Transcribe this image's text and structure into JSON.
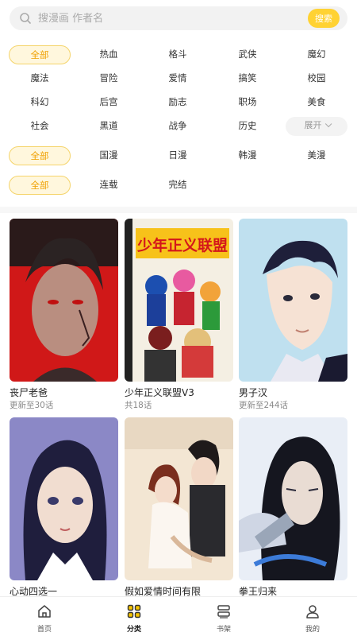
{
  "search": {
    "placeholder": "搜漫画 作者名",
    "button_label": "搜索"
  },
  "filters": {
    "genre": [
      "全部",
      "热血",
      "格斗",
      "武侠",
      "魔幻",
      "魔法",
      "冒险",
      "爱情",
      "搞笑",
      "校园",
      "科幻",
      "后宫",
      "励志",
      "职场",
      "美食",
      "社会",
      "黑道",
      "战争",
      "历史"
    ],
    "expand_label": "展开",
    "region": [
      "全部",
      "国漫",
      "日漫",
      "韩漫",
      "美漫"
    ],
    "status": [
      "全部",
      "连载",
      "完结"
    ]
  },
  "comics": [
    {
      "title": "丧尸老爸",
      "subtitle": "更新至30话"
    },
    {
      "title": "少年正义联盟V3",
      "subtitle": "共18话",
      "cover_text": "少年正义联盟"
    },
    {
      "title": "男子汉",
      "subtitle": "更新至244话"
    },
    {
      "title": "心动四选一",
      "subtitle": ""
    },
    {
      "title": "假如爱情时间有限",
      "subtitle": ""
    },
    {
      "title": "拳王归来",
      "subtitle": ""
    }
  ],
  "tabbar": [
    {
      "label": "首页",
      "icon": "home-icon"
    },
    {
      "label": "分类",
      "icon": "category-icon"
    },
    {
      "label": "书架",
      "icon": "bookshelf-icon"
    },
    {
      "label": "我的",
      "icon": "profile-icon"
    }
  ],
  "colors": {
    "accent": "#ffd233",
    "chip_active_bg": "#fff7dd",
    "chip_active_text": "#f0a000"
  }
}
